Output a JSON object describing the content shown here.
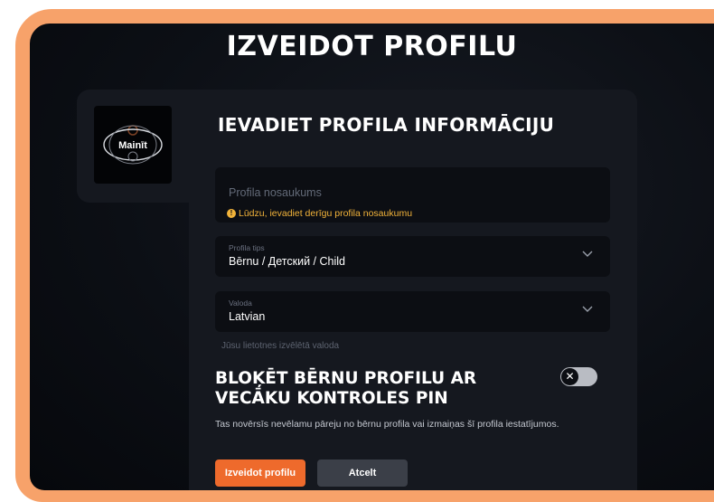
{
  "page": {
    "title": "IZVEIDOT PROFILU"
  },
  "avatar": {
    "change_label": "Mainīt"
  },
  "form": {
    "section_title": "IEVADIET PROFILA INFORMĀCIJU",
    "name_field": {
      "placeholder": "Profila nosaukums",
      "value": "",
      "error": "Lūdzu, ievadiet derīgu profila nosaukumu"
    },
    "profile_type": {
      "label": "Profila tips",
      "value": "Bērnu / Детский / Child"
    },
    "language": {
      "label": "Valoda",
      "value": "Latvian",
      "helper": "Jūsu lietotnes izvēlētā valoda"
    }
  },
  "pin_lock": {
    "title_line1": "BLOĶĒT BĒRNU PROFILU AR",
    "title_line2": "VECĀKU KONTROLES PIN",
    "description": "Tas novērsīs nevēlamu pāreju no bērnu profila vai izmaiņas šī profila iestatījumos.",
    "enabled": false
  },
  "actions": {
    "create_label": "Izveidot profilu",
    "cancel_label": "Atcelt"
  },
  "colors": {
    "accent": "#ee6a2c",
    "warning": "#f2b33a",
    "frame": "#f7a26a"
  },
  "icons": {
    "warning": "warning-icon",
    "chevron": "chevron-down-icon",
    "toggle_off": "close-icon"
  }
}
